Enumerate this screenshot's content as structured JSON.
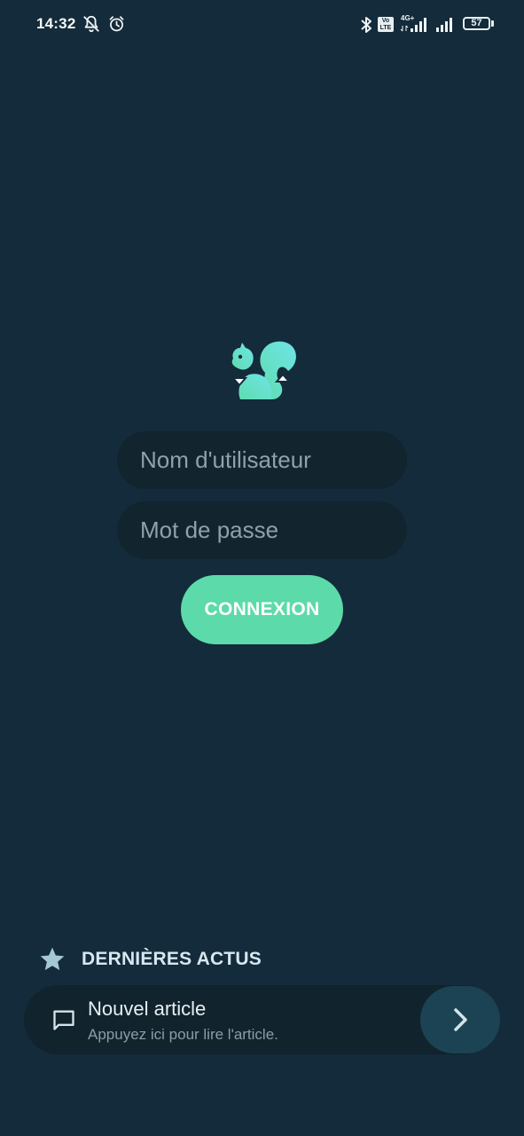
{
  "status_bar": {
    "time": "14:32",
    "left_icons": [
      "muted-bell-icon",
      "alarm-icon"
    ],
    "right_icons": [
      "bluetooth-icon",
      "volte-icon",
      "signal-4g-icon",
      "signal-icon",
      "battery-icon"
    ],
    "volte_text_top": "Vo",
    "volte_text_bottom": "LTE",
    "network_label": "4G+",
    "battery_level": "57"
  },
  "login": {
    "logo_icon": "squirrel-icon",
    "username_placeholder": "Nom d'utilisateur",
    "password_placeholder": "Mot de passe",
    "username_value": "",
    "password_value": "",
    "submit_label": "CONNEXION"
  },
  "news": {
    "header_icon": "star-icon",
    "header_title": "DERNIÈRES ACTUS",
    "item": {
      "icon": "chat-bubble-icon",
      "title": "Nouvel article",
      "subtitle": "Appuyez ici pour lire l'article.",
      "action_icon": "chevron-right-icon"
    }
  },
  "colors": {
    "background": "#132b3a",
    "field_background": "#12242e",
    "accent": "#5ddaa9",
    "next_button": "#1b4354",
    "logo_gradient_start": "#5fdcb0",
    "logo_gradient_end": "#6fe4e6"
  }
}
